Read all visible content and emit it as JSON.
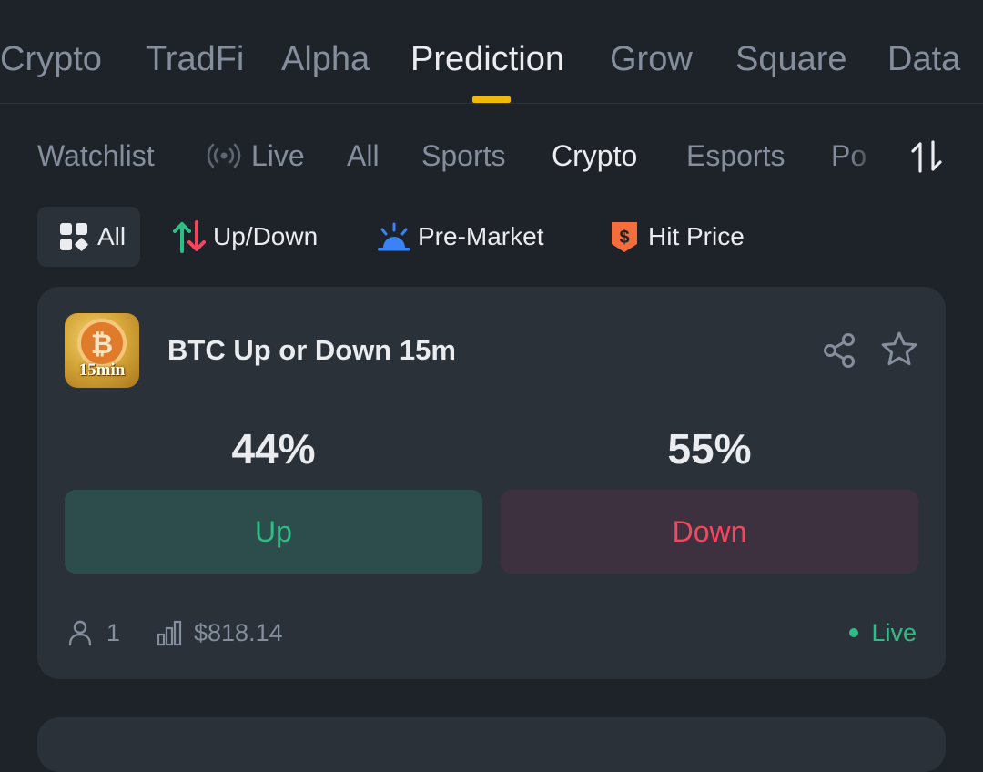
{
  "top_nav": {
    "tabs": [
      {
        "label": "Crypto"
      },
      {
        "label": "TradFi"
      },
      {
        "label": "Alpha"
      },
      {
        "label": "Prediction"
      },
      {
        "label": "Grow"
      },
      {
        "label": "Square"
      },
      {
        "label": "Data"
      }
    ],
    "active": "Prediction",
    "accent_color": "#f0b90b"
  },
  "sub_nav": {
    "tabs": [
      {
        "label": "Watchlist"
      },
      {
        "label": "Live",
        "icon": "broadcast-icon"
      },
      {
        "label": "All"
      },
      {
        "label": "Sports"
      },
      {
        "label": "Crypto"
      },
      {
        "label": "Esports"
      },
      {
        "label": "Po"
      }
    ],
    "active": "Crypto",
    "sort_icon": "sort-arrows-icon"
  },
  "filters": {
    "chips": [
      {
        "label": "All",
        "icon": "grid-icon"
      },
      {
        "label": "Up/Down",
        "icon": "up-down-arrows-icon"
      },
      {
        "label": "Pre-Market",
        "icon": "sunrise-icon"
      },
      {
        "label": "Hit Price",
        "icon": "dollar-shield-icon"
      }
    ],
    "active": "All"
  },
  "market_card": {
    "logo_text": "15min",
    "title": "BTC Up or Down 15m",
    "up": {
      "percent": "44%",
      "label": "Up",
      "color": "#2ebd85"
    },
    "down": {
      "percent": "55%",
      "label": "Down",
      "color": "#f6465d"
    },
    "participants": "1",
    "volume": "$818.14",
    "status": "Live"
  }
}
